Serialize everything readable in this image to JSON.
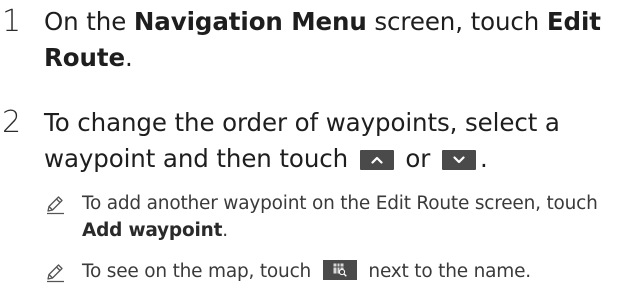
{
  "steps": [
    {
      "number": "1",
      "parts": {
        "p1": "On the ",
        "b1": "Navigation Menu",
        "p2": " screen, touch ",
        "b2": "Edit Route",
        "p3": "."
      }
    },
    {
      "number": "2",
      "parts": {
        "p1": "To change the order of waypoints, select a waypoint and then touch ",
        "or": " or ",
        "end": "."
      },
      "icons": [
        "chevron-up-icon",
        "chevron-down-icon"
      ]
    }
  ],
  "notes": [
    {
      "icon": "pencil-icon",
      "p1": "To add another waypoint on the Edit Route screen, touch ",
      "b1": "Add waypoint",
      "p2": "."
    },
    {
      "icon": "pencil-icon",
      "p1": "To see on the map, touch ",
      "map_icon": "map-preview-icon",
      "p2": " next to the name."
    }
  ],
  "colors": {
    "text": "#1e1e1e",
    "note_text": "#3a3a3a",
    "control_bg": "#4a4a4a",
    "icon_line": "#555555"
  }
}
